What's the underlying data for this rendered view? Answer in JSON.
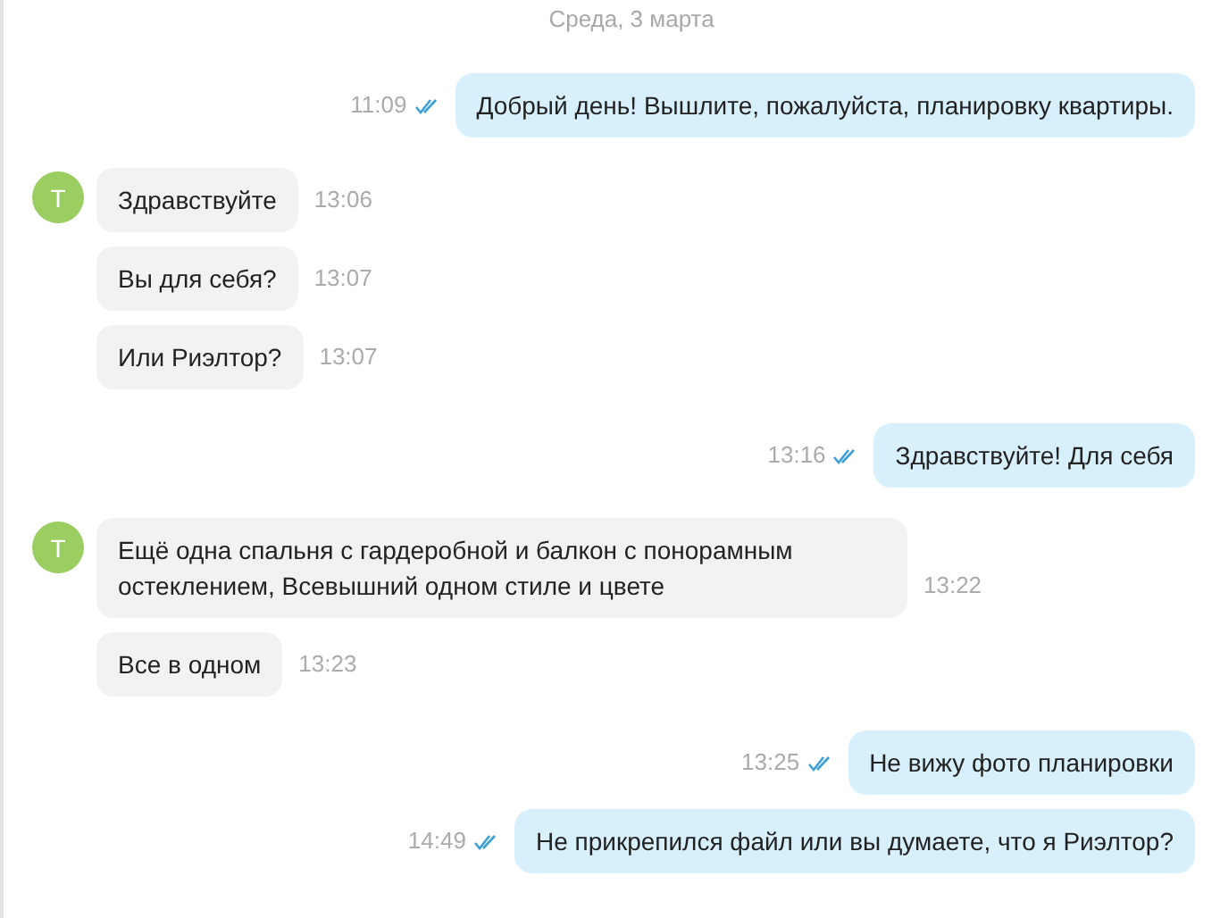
{
  "date_divider": "Среда, 3 марта",
  "groups": [
    {
      "kind": "sent",
      "messages": [
        {
          "text": "Добрый день! Вышлите, пожалуйста, планировку квартиры.",
          "time": "11:09",
          "read": true
        }
      ]
    },
    {
      "kind": "received",
      "avatar": "T",
      "messages": [
        {
          "text": "Здравствуйте",
          "time": "13:06"
        },
        {
          "text": "Вы для себя?",
          "time": "13:07"
        },
        {
          "text": "Или Риэлтор?",
          "time": "13:07"
        }
      ]
    },
    {
      "kind": "sent",
      "messages": [
        {
          "text": "Здравствуйте! Для себя",
          "time": "13:16",
          "read": true
        }
      ]
    },
    {
      "kind": "received",
      "avatar": "T",
      "messages": [
        {
          "text": "Ещё одна спальня с гардеробной и балкон с понорамным остеклением, Всевышний одном стиле и цвете",
          "time": "13:22"
        },
        {
          "text": "Все в одном",
          "time": "13:23"
        }
      ]
    },
    {
      "kind": "sent",
      "messages": [
        {
          "text": "Не вижу фото планировки",
          "time": "13:25",
          "read": true
        },
        {
          "text": "Не прикрепился файл или вы думаете, что я Риэлтор?",
          "time": "14:49",
          "read": true
        }
      ]
    }
  ]
}
